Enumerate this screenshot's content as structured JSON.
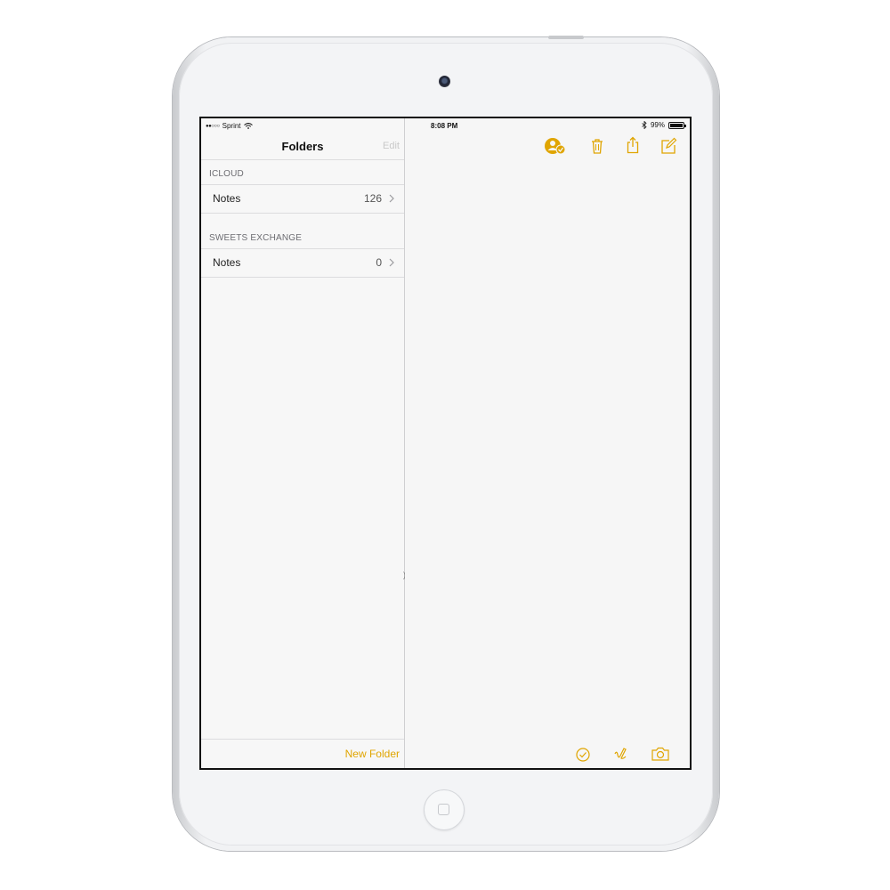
{
  "status_bar": {
    "carrier": "Sprint",
    "signal": "●●○○○",
    "time": "8:08 PM",
    "battery": "99%"
  },
  "sidebar": {
    "title": "Folders",
    "edit_label": "Edit",
    "sections": [
      {
        "label": "ICLOUD",
        "folders": [
          {
            "name": "Notes",
            "count": "126"
          }
        ]
      },
      {
        "label": "SWEETS EXCHANGE",
        "folders": [
          {
            "name": "Notes",
            "count": "0"
          }
        ]
      }
    ],
    "new_folder_label": "New Folder"
  },
  "toolbar": {
    "icons": [
      "add-people-icon",
      "trash-icon",
      "share-icon",
      "compose-icon"
    ],
    "bottom_icons": [
      "checklist-icon",
      "sketch-icon",
      "camera-icon"
    ]
  },
  "colors": {
    "accent": "#e0a500",
    "disabled": "#c9c9c9",
    "background": "#f6f6f6"
  }
}
